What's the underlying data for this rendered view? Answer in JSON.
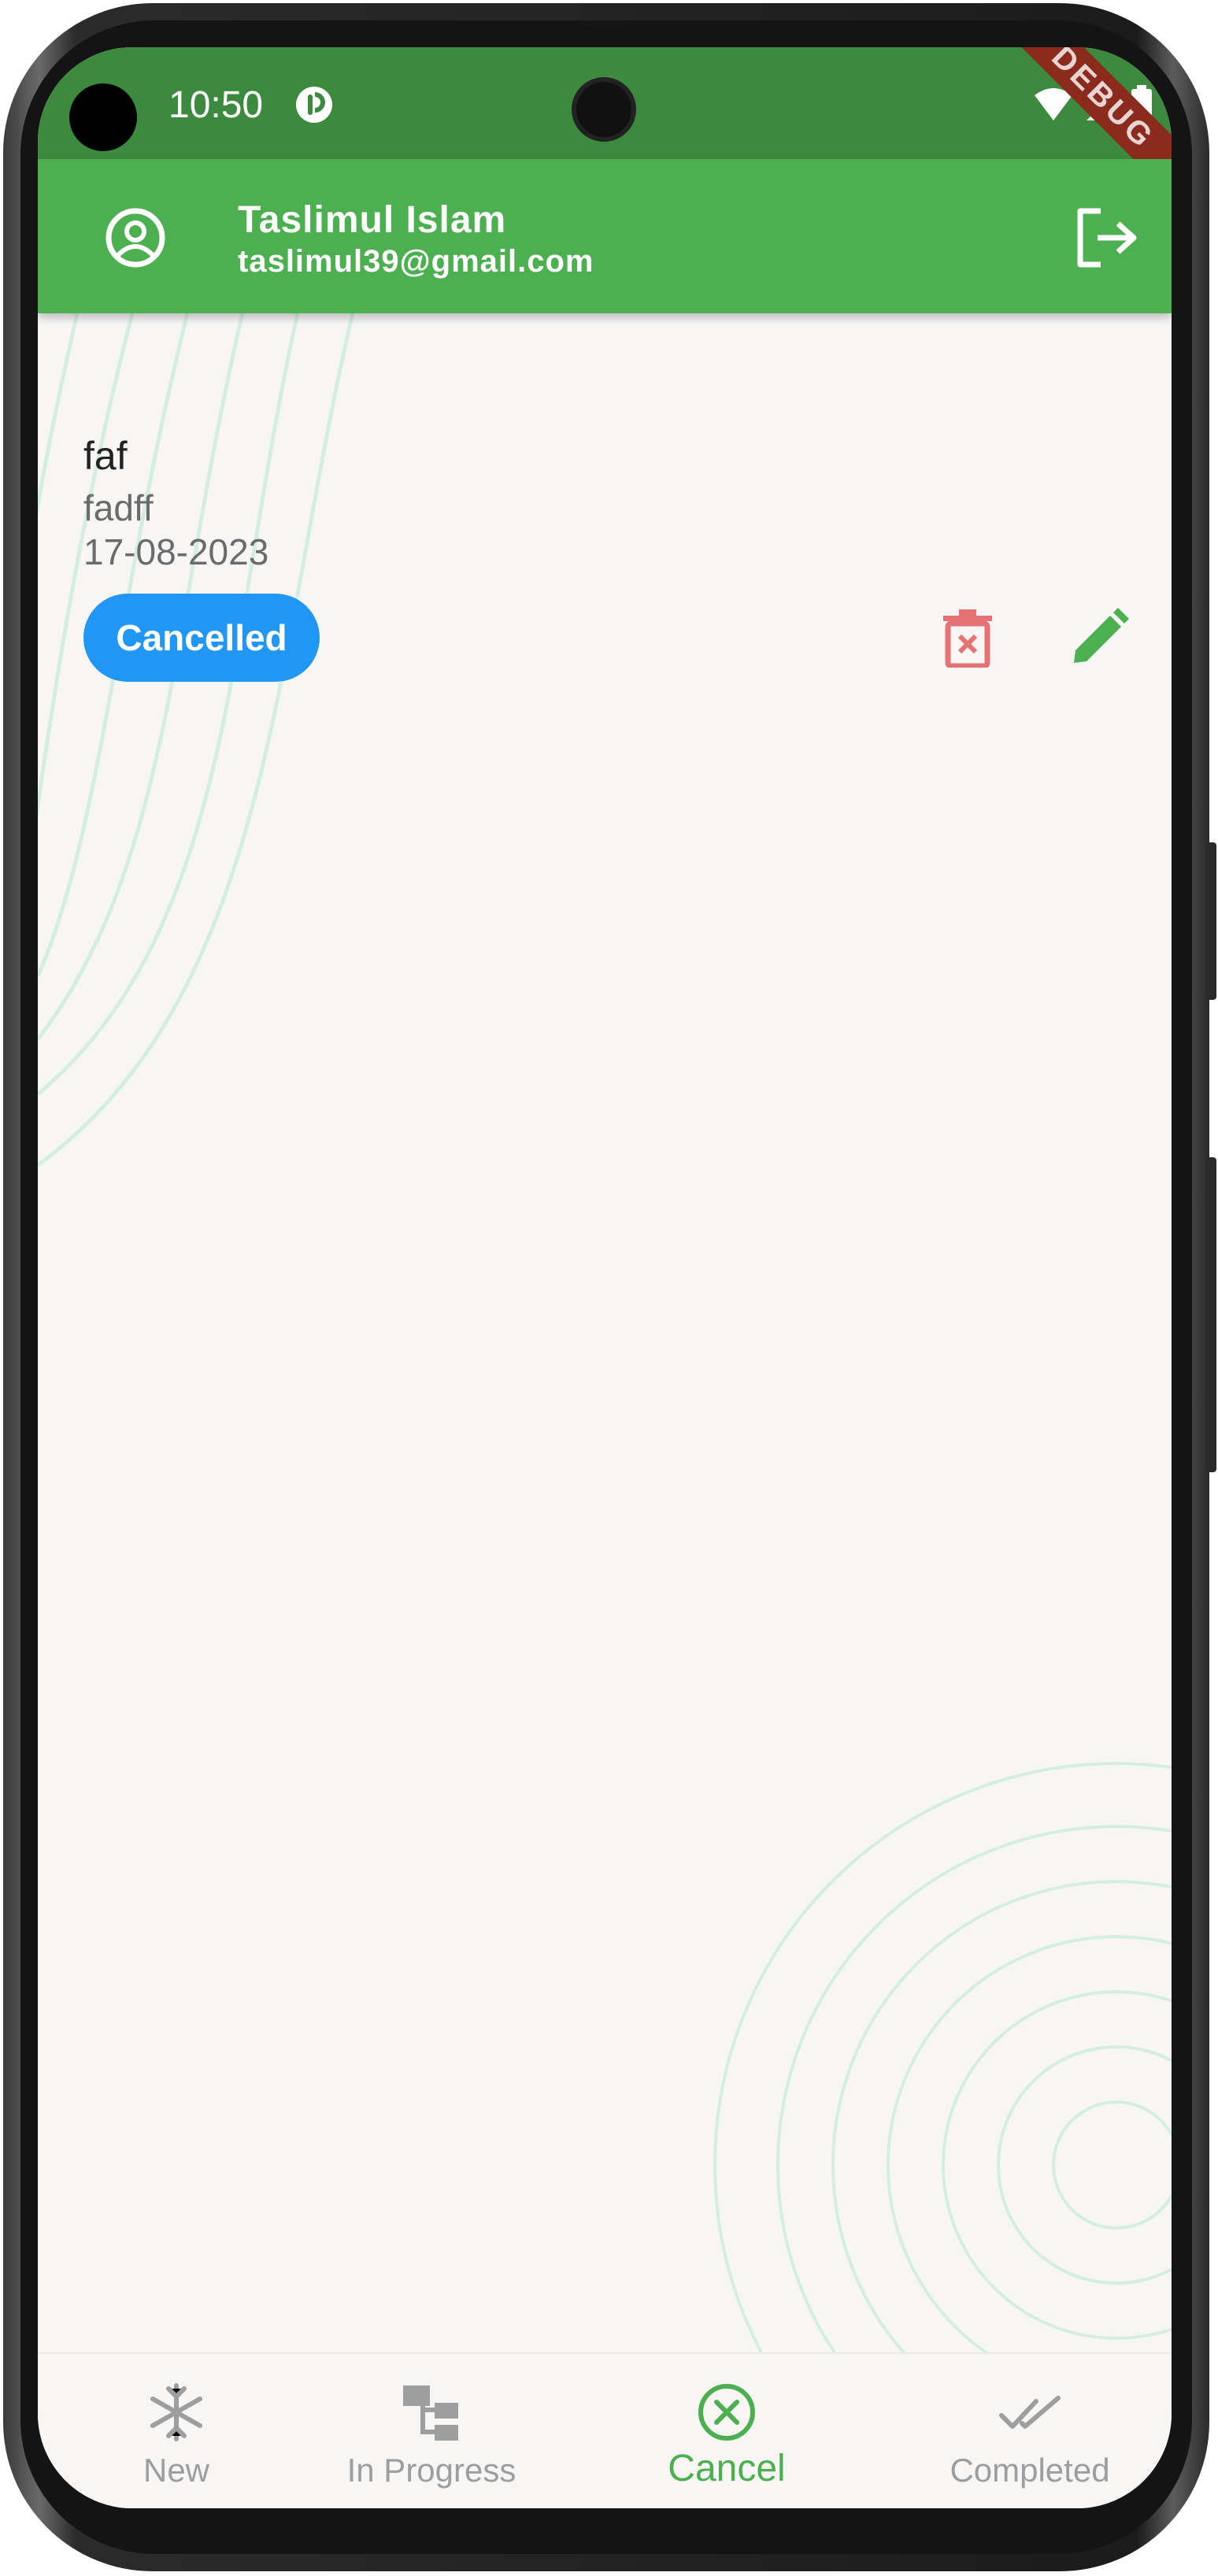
{
  "status_bar": {
    "time": "10:50",
    "debug_banner": "DEBUG",
    "icons": [
      "app-notification-icon",
      "wifi-icon",
      "signal-icon",
      "battery-icon"
    ]
  },
  "app_bar": {
    "user_name": "Taslimul Islam",
    "user_email": "taslimul39@gmail.com",
    "avatar_icon": "account-circle-icon",
    "logout_icon": "logout-icon",
    "background_color": "#4caf50"
  },
  "tasks": [
    {
      "title": "faf",
      "description": "fadff",
      "date": "17-08-2023",
      "status": "Cancelled",
      "status_color": "#2196f3",
      "actions": [
        "delete-icon",
        "edit-icon"
      ]
    }
  ],
  "bottom_nav": {
    "items": [
      {
        "label": "New",
        "icon": "snowflake-icon",
        "active": false
      },
      {
        "label": "In Progress",
        "icon": "hierarchy-icon",
        "active": false
      },
      {
        "label": "Cancel",
        "icon": "cancel-circle-icon",
        "active": true
      },
      {
        "label": "Completed",
        "icon": "double-check-icon",
        "active": false
      }
    ],
    "active_color": "#4caf50",
    "inactive_color": "#9e9e9e"
  }
}
